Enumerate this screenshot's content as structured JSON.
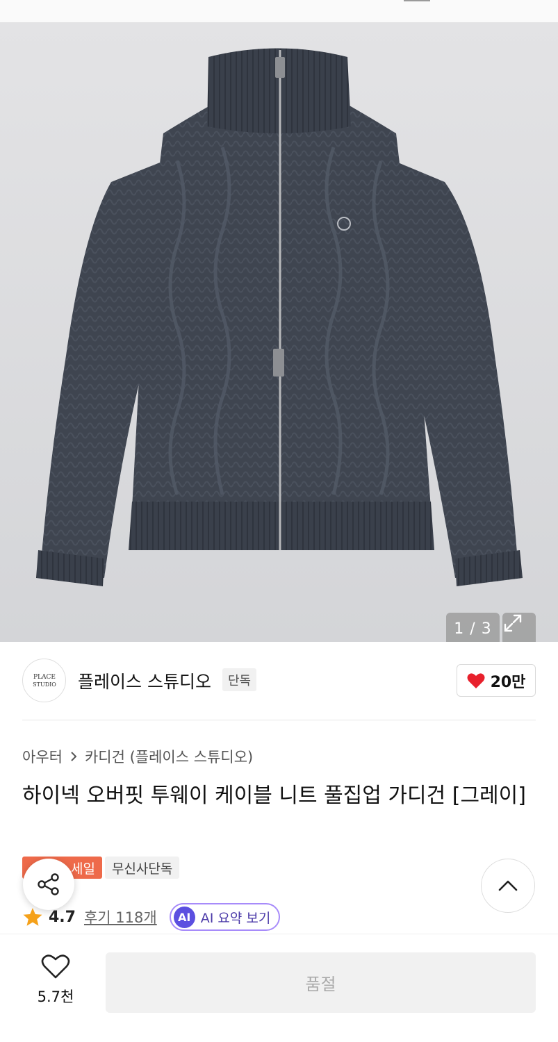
{
  "gallery": {
    "counter": "1 / 3",
    "expand_icon": "expand-icon",
    "image_description_icon": "cardigan-photo"
  },
  "brand": {
    "logo_text": "PLACE STUDIO",
    "name": "플레이스 스튜디오",
    "tag": "단독",
    "like_count": "20만",
    "heart_color": "#e8202c"
  },
  "breadcrumb": {
    "category": "아우터",
    "subcategory": "카디건 (플레이스 스튜디오)"
  },
  "product": {
    "title": "하이넥 오버핏 투웨이 케이블 니트 풀집업 가디건 [그레이]",
    "badge_sale": "세일",
    "badge_exclusive": "무신사단독",
    "sale_color": "#ee6a4a"
  },
  "rating": {
    "score": "4.7",
    "reviews": "후기 118개",
    "star_color": "#f5a11a"
  },
  "ai": {
    "badge": "AI",
    "label": "AI 요약 보기"
  },
  "bottom": {
    "wish_count": "5.7천",
    "soldout_label": "품절"
  }
}
